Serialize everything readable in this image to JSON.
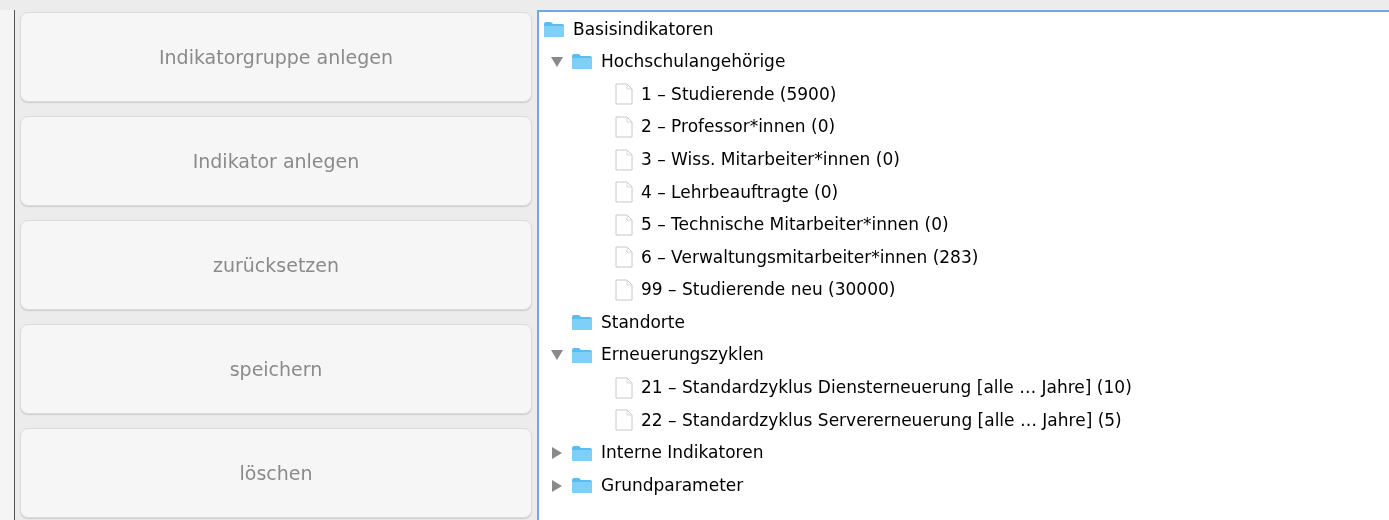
{
  "buttons": [
    {
      "label": "Indikatorgruppe anlegen",
      "disabled": true
    },
    {
      "label": "Indikator anlegen",
      "disabled": true
    },
    {
      "label": "zurücksetzen",
      "disabled": true
    },
    {
      "label": "speichern",
      "disabled": true
    },
    {
      "label": "löschen",
      "disabled": true
    }
  ],
  "tree": {
    "label": "Basisindikatoren",
    "kind": "folder",
    "children": [
      {
        "label": "Hochschulangehörige",
        "kind": "folder",
        "expanded": true,
        "children": [
          {
            "label": "1 – Studierende (5900)",
            "kind": "file"
          },
          {
            "label": "2 – Professor*innen (0)",
            "kind": "file"
          },
          {
            "label": "3 – Wiss. Mitarbeiter*innen (0)",
            "kind": "file"
          },
          {
            "label": "4 – Lehrbeauftragte (0)",
            "kind": "file"
          },
          {
            "label": "5 – Technische Mitarbeiter*innen (0)",
            "kind": "file"
          },
          {
            "label": "6 – Verwaltungsmitarbeiter*innen (283)",
            "kind": "file"
          },
          {
            "label": "99 – Studierende neu (30000)",
            "kind": "file"
          }
        ]
      },
      {
        "label": "Standorte",
        "kind": "folder"
      },
      {
        "label": "Erneuerungszyklen",
        "kind": "folder",
        "expanded": true,
        "children": [
          {
            "label": "21 – Standardzyklus Diensterneuerung [alle … Jahre] (10)",
            "kind": "file"
          },
          {
            "label": "22 – Standardzyklus Servererneuerung [alle … Jahre] (5)",
            "kind": "file"
          }
        ]
      },
      {
        "label": "Interne Indikatoren",
        "kind": "folder",
        "expanded": false
      },
      {
        "label": "Grundparameter",
        "kind": "folder",
        "expanded": false
      }
    ]
  }
}
